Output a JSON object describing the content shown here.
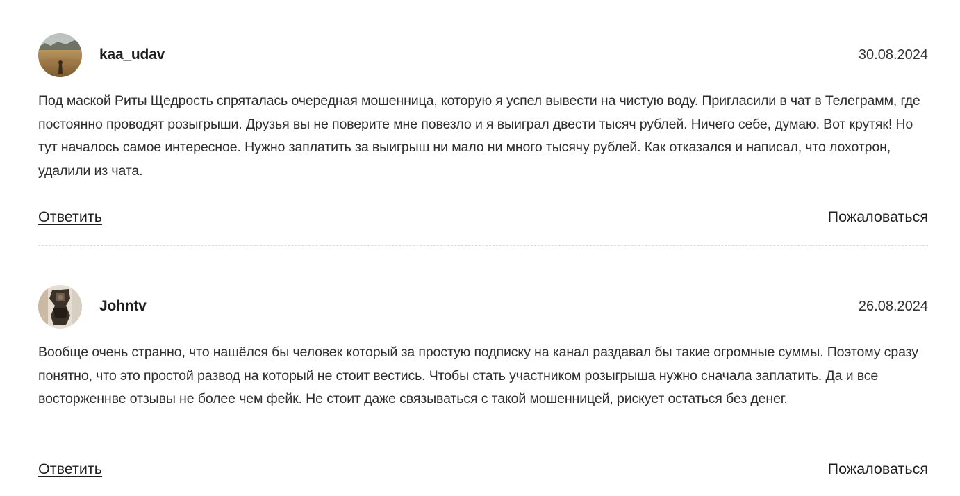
{
  "comments": [
    {
      "author": "kaa_udav",
      "date": "30.08.2024",
      "text": "Под маской Риты Щедрость спряталась очередная мошенница, которую я успел вывести на чистую воду. Пригласили в чат в Телеграмм, где постоянно проводят розыгрыши. Друзья вы не поверите мне повезло и я выиграл двести тысяч рублей. Ничего себе, думаю. Вот крутяк! Но тут началось самое интересное. Нужно заплатить за выигрыш ни мало ни много тысячу рублей. Как отказался и написал, что лохотрон, удалили из чата.",
      "reply_label": "Ответить",
      "complain_label": "Пожаловаться"
    },
    {
      "author": "Johntv",
      "date": "26.08.2024",
      "text": "Вообще очень странно, что нашёлся бы человек который за простую подписку на канал раздавал бы такие огромные суммы. Поэтому сразу понятно, что это простой развод на который не стоит вестись. Чтобы стать участником розыгрыша нужно сначала заплатить. Да и все восторженнве отзывы не более чем фейк. Не стоит даже связываться с такой мошенницей, рискует остаться без денег.",
      "reply_label": "Ответить",
      "complain_label": "Пожаловаться"
    }
  ]
}
